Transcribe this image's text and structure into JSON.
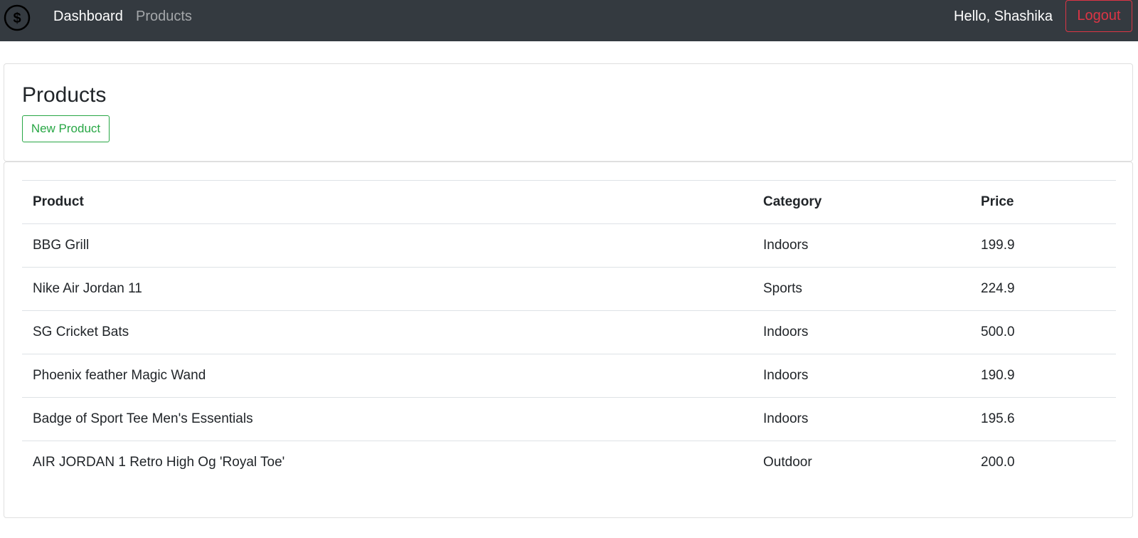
{
  "navbar": {
    "brand_icon": "dollar-circle-icon",
    "links": [
      {
        "label": "Dashboard"
      },
      {
        "label": "Products"
      }
    ],
    "greeting": "Hello, Shashika",
    "logout_label": "Logout"
  },
  "header": {
    "title": "Products",
    "new_button_label": "New Product"
  },
  "table": {
    "columns": [
      "Product",
      "Category",
      "Price"
    ],
    "rows": [
      [
        "BBG Grill",
        "Indoors",
        "199.9"
      ],
      [
        "Nike Air Jordan 11",
        "Sports",
        "224.9"
      ],
      [
        "SG Cricket Bats",
        "Indoors",
        "500.0"
      ],
      [
        "Phoenix feather Magic Wand",
        "Indoors",
        "190.9"
      ],
      [
        "Badge of Sport Tee Men's Essentials",
        "Indoors",
        "195.6"
      ],
      [
        "AIR JORDAN 1 Retro High Og 'Royal Toe'",
        "Outdoor",
        "200.0"
      ]
    ]
  },
  "colors": {
    "navbar_bg": "#343a40",
    "danger": "#dc3545",
    "success": "#28a745"
  }
}
